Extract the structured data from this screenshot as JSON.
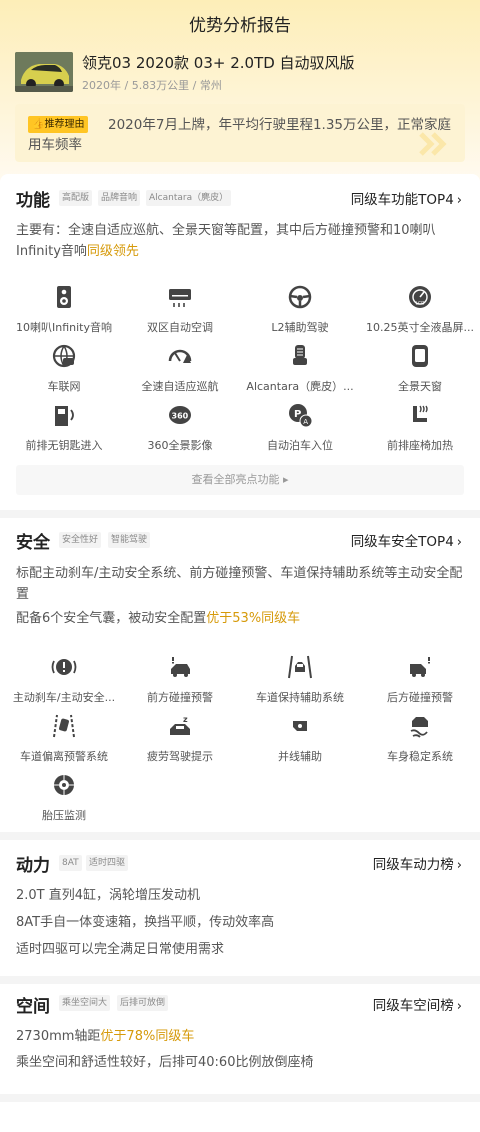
{
  "page_title": "优势分析报告",
  "car": {
    "name": "领克03 2020款 03+ 2.0TD 自动驭风版",
    "meta": "2020年 / 5.83万公里 / 常州"
  },
  "reason": {
    "tag": "推荐理由",
    "text": "2020年7月上牌，年平均行驶里程1.35万公里，正常家庭用车频率"
  },
  "function": {
    "title": "功能",
    "tags": [
      "高配版",
      "品牌音响",
      "Alcantara（麂皮）"
    ],
    "rank": "同级车功能TOP4",
    "desc_main": "主要有：全速自适应巡航、全景天窗等配置，其中后方碰撞预警和10喇叭Infinity音响",
    "desc_hl": "同级领先",
    "items": [
      {
        "label": "10喇叭Infinity音响",
        "icon": "speaker-icon"
      },
      {
        "label": "双区自动空调",
        "icon": "air-conditioner-icon"
      },
      {
        "label": "L2辅助驾驶",
        "icon": "steering-wheel-icon"
      },
      {
        "label": "10.25英寸全液晶屏...",
        "icon": "lcd-gauge-icon"
      },
      {
        "label": "车联网",
        "icon": "connected-car-icon"
      },
      {
        "label": "全速自适应巡航",
        "icon": "cruise-control-icon"
      },
      {
        "label": "Alcantara（麂皮）...",
        "icon": "seat-icon"
      },
      {
        "label": "全景天窗",
        "icon": "sunroof-icon"
      },
      {
        "label": "前排无钥匙进入",
        "icon": "keyless-door-icon"
      },
      {
        "label": "360全景影像",
        "icon": "camera-360-icon"
      },
      {
        "label": "自动泊车入位",
        "icon": "auto-parking-icon"
      },
      {
        "label": "前排座椅加热",
        "icon": "seat-heating-icon"
      }
    ],
    "more_button": "查看全部亮点功能"
  },
  "safety": {
    "title": "安全",
    "tags": [
      "安全性好",
      "智能驾驶"
    ],
    "rank": "同级车安全TOP4",
    "desc1": "标配主动刹车/主动安全系统、前方碰撞预警、车道保持辅助系统等主动安全配置",
    "desc2_main": "配备6个安全气囊，被动安全配置",
    "desc2_hl": "优于53%同级车",
    "items": [
      {
        "label": "主动刹车/主动安全...",
        "icon": "active-brake-icon"
      },
      {
        "label": "前方碰撞预警",
        "icon": "front-collision-icon"
      },
      {
        "label": "车道保持辅助系统",
        "icon": "lane-keep-icon"
      },
      {
        "label": "后方碰撞预警",
        "icon": "rear-collision-icon"
      },
      {
        "label": "车道偏离预警系统",
        "icon": "lane-departure-icon"
      },
      {
        "label": "疲劳驾驶提示",
        "icon": "fatigue-icon"
      },
      {
        "label": "并线辅助",
        "icon": "blind-spot-icon"
      },
      {
        "label": "车身稳定系统",
        "icon": "stability-icon"
      },
      {
        "label": "胎压监测",
        "icon": "tire-pressure-icon"
      }
    ]
  },
  "power": {
    "title": "动力",
    "tags": [
      "8AT",
      "适时四驱"
    ],
    "rank": "同级车动力榜",
    "lines": [
      "2.0T 直列4缸，涡轮增压发动机",
      "8AT手自一体变速箱，换挡平顺，传动效率高",
      "适时四驱可以完全满足日常使用需求"
    ]
  },
  "space": {
    "title": "空间",
    "tags": [
      "乘坐空间大",
      "后排可放倒"
    ],
    "rank": "同级车空间榜",
    "line1_main": "2730mm轴距",
    "line1_hl": "优于78%同级车",
    "line2": "乘坐空间和舒适性较好，后排可40:60比例放倒座椅"
  },
  "colors": {
    "accent": "#d69a0a",
    "tag_yellow": "#ffc524",
    "header_bg": "#fdeeb8"
  }
}
